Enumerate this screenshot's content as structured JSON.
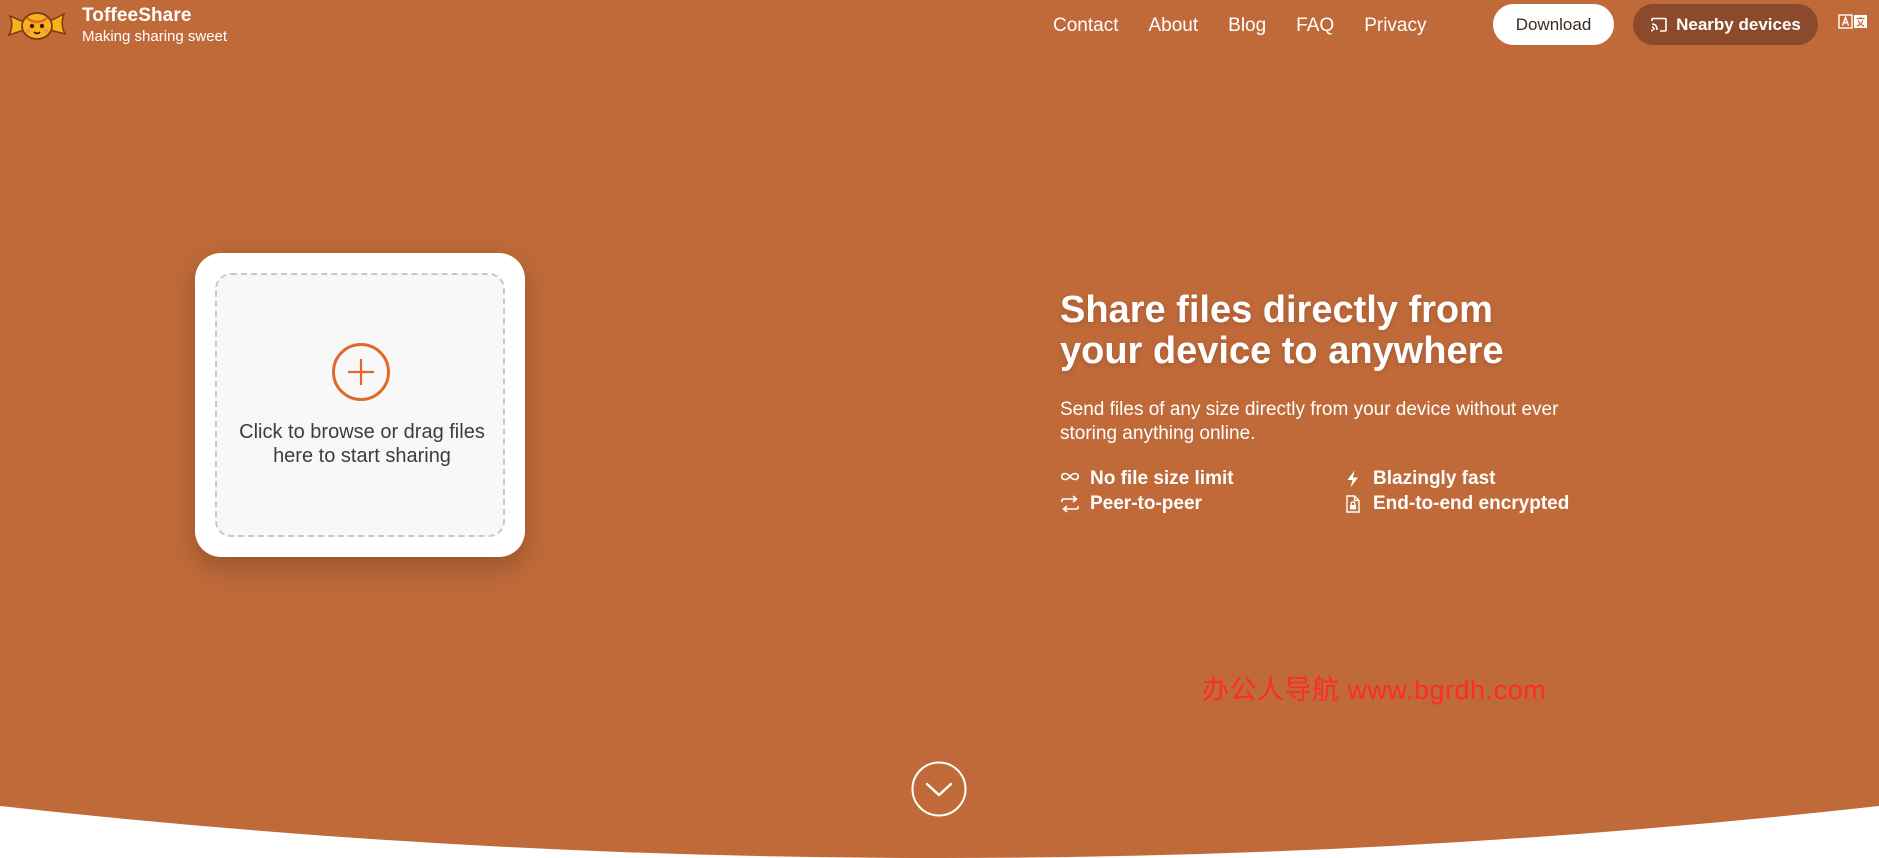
{
  "colors": {
    "hero_bg": "#C06A3A",
    "accent_orange": "#E2672A",
    "nearby_button_bg": "#8B4A2C",
    "watermark": "#FF2A2A"
  },
  "header": {
    "logo_icon": "candy-logo",
    "brand_name": "ToffeeShare",
    "tagline": "Making sharing sweet",
    "nav": [
      {
        "label": "Contact"
      },
      {
        "label": "About"
      },
      {
        "label": "Blog"
      },
      {
        "label": "FAQ"
      },
      {
        "label": "Privacy"
      }
    ],
    "download_label": "Download",
    "nearby_label": "Nearby devices",
    "nearby_icon": "cast-icon",
    "language_icon": "translate-icon"
  },
  "upload": {
    "icon": "plus-circle-icon",
    "text": "Click to browse or drag files here to start sharing"
  },
  "hero": {
    "headline_line1": "Share files directly from",
    "headline_line2": "your device to anywhere",
    "subtext": "Send files of any size directly from your device without ever storing anything online.",
    "features": [
      {
        "icon": "infinity-icon",
        "label": "No file size limit"
      },
      {
        "icon": "lightning-icon",
        "label": "Blazingly fast"
      },
      {
        "icon": "swap-arrows-icon",
        "label": "Peer-to-peer"
      },
      {
        "icon": "lock-file-icon",
        "label": "End-to-end encrypted"
      }
    ]
  },
  "watermark": "办公人导航 www.bgrdh.com",
  "scroll_icon": "chevron-down-circle-icon"
}
